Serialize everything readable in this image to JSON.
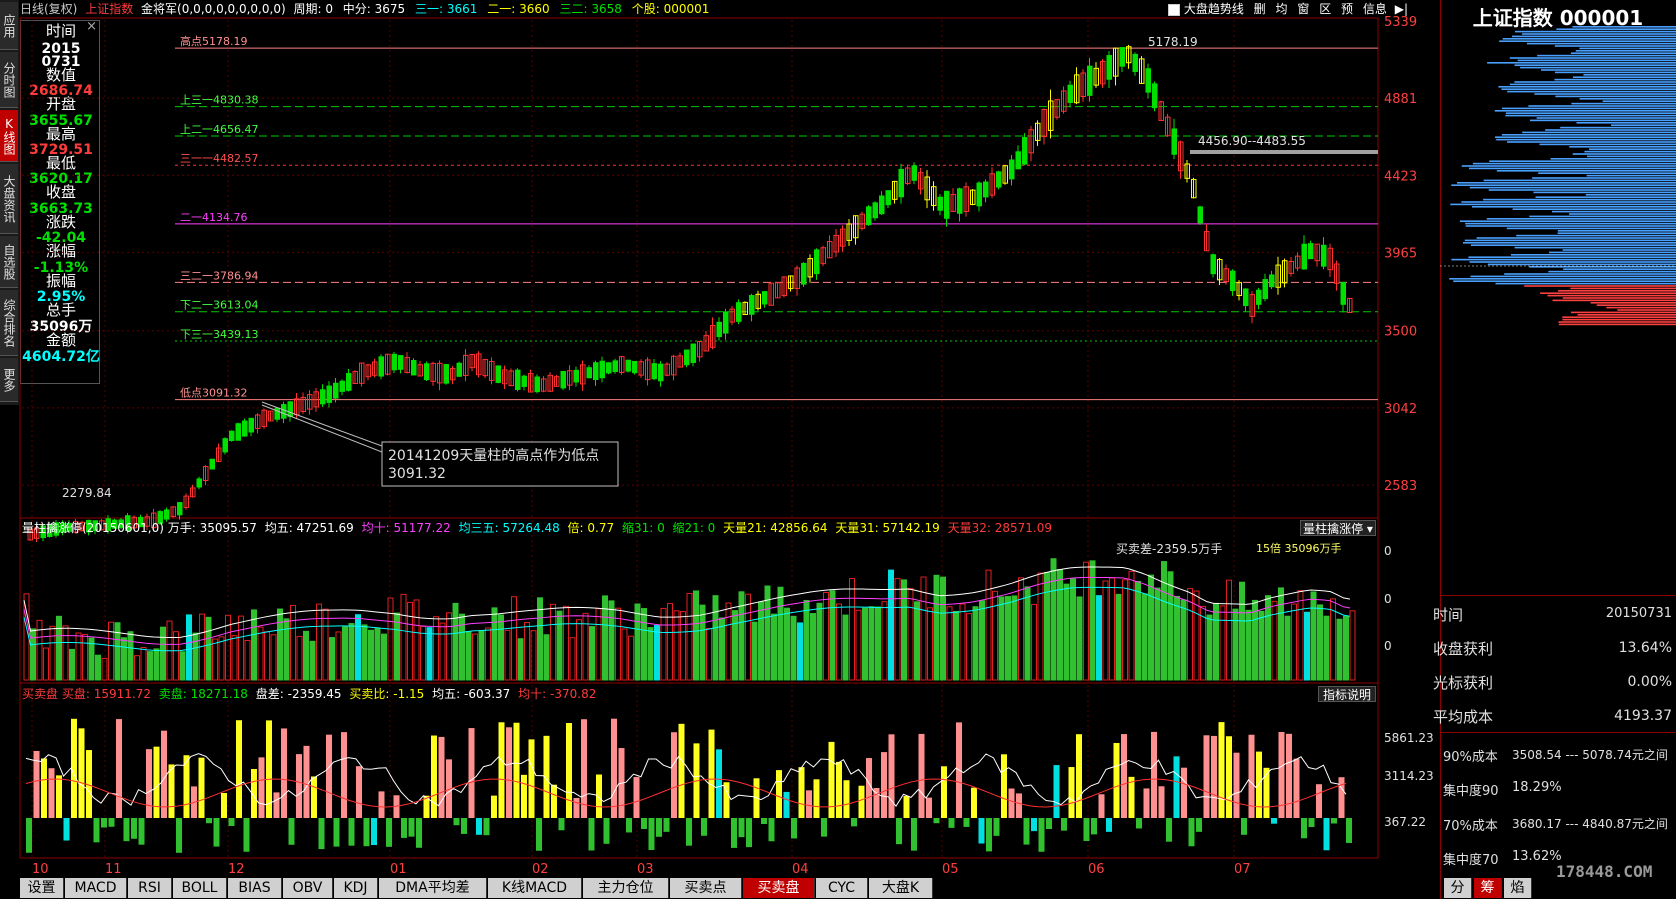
{
  "topbar": {
    "period": "日线(复权)",
    "index_name": "上证指数",
    "indicator": "金将军(0,0,0,0,0,0,0,0,0)",
    "cycle_label": "周期: 0",
    "mid_label": "中分: 3675",
    "s31_label": "三一: 3661",
    "e1_label": "二一: 3660",
    "s32_label": "三二: 3658",
    "stock_label": "个股: 000001",
    "btn_trend": "大盘趋势线",
    "btn_del": "删",
    "btn_jun": "均",
    "btn_win": "窗",
    "btn_area": "区",
    "btn_pre": "预",
    "btn_info": "信息"
  },
  "sidebar": {
    "items": [
      {
        "label": "应用"
      },
      {
        "label": "分时图"
      },
      {
        "label": "K线图"
      },
      {
        "label": "大盘资讯"
      },
      {
        "label": "自选股"
      },
      {
        "label": "综合排名"
      },
      {
        "label": "更多"
      }
    ]
  },
  "info_panel": {
    "time_label": "时间",
    "date_year": "2015",
    "date_md": "0731",
    "value_label": "数值",
    "value": "2686.74",
    "open_label": "开盘",
    "open": "3655.67",
    "high_label": "最高",
    "high": "3729.51",
    "low_label": "最低",
    "low": "3620.17",
    "close_label": "收盘",
    "close": "3663.73",
    "change_label": "涨跌",
    "change": "-42.04",
    "pct_label": "涨幅",
    "pct": "-1.13%",
    "amp_label": "振幅",
    "amp": "2.95%",
    "vol_label": "总手",
    "vol": "35096万",
    "amount_label": "金额",
    "amount": "4604.72亿"
  },
  "main_chart": {
    "levels": [
      {
        "label": "高点5178.19",
        "value": 5178.19
      },
      {
        "label": "上三一4830.38",
        "value": 4830.38
      },
      {
        "label": "上二一4656.47",
        "value": 4656.47
      },
      {
        "label": "三一一4482.57",
        "value": 4482.57
      },
      {
        "label": "二一4134.76",
        "value": 4134.76
      },
      {
        "label": "三二一3786.94",
        "value": 3786.94
      },
      {
        "label": "下二一3613.04",
        "value": 3613.04
      },
      {
        "label": "下三一3439.13",
        "value": 3439.13
      },
      {
        "label": "低点3091.32",
        "value": 3091.32
      }
    ],
    "peak_label": "5178.19",
    "low_start_label": "2279.84",
    "gap_label": "4456.90--4483.55",
    "annotation_line1": "20141209天量柱的高点作为低点",
    "annotation_line2": "3091.32",
    "y_ticks": [
      "5339",
      "4881",
      "4423",
      "3965",
      "3500",
      "3042",
      "2583"
    ]
  },
  "volume_panel": {
    "title": "量柱擒涨停(20150601,0)",
    "vol_label": "万手: 35095.57",
    "avg_label": "均五: 47251.69",
    "avg10_label": "均十: 51177.22",
    "avg35_label": "均三五: 57264.48",
    "mult_label": "倍: 0.77",
    "shrink31_label": "缩31: 0",
    "shrink21_label": "缩21: 0",
    "tian21_label": "天量21: 42856.64",
    "tian31_label": "天量31: 57142.19",
    "tian32_label": "天量32: 28571.09",
    "dropdown": "量柱擒涨停",
    "note1": "买卖差-2359.5万手",
    "note2": "15倍  35096万手",
    "y_ticks": [
      "0",
      "0",
      "0"
    ]
  },
  "bs_panel": {
    "title": "买卖盘",
    "buy_label": "买盘: 15911.72",
    "sell_label": "卖盘: 18271.18",
    "diff_label": "盘差: -2359.45",
    "ratio_label": "买卖比: -1.15",
    "avg5_label": "均五: -603.37",
    "avg10_label": "均十: -370.82",
    "help_btn": "指标说明",
    "y_ticks": [
      "5861.23",
      "3114.23",
      "367.22"
    ]
  },
  "x_axis": {
    "months": [
      "10",
      "11",
      "12",
      "01",
      "02",
      "03",
      "04",
      "05",
      "06",
      "07"
    ]
  },
  "bottom_tabs": {
    "items": [
      {
        "label": "设置"
      },
      {
        "label": "MACD"
      },
      {
        "label": "RSI"
      },
      {
        "label": "BOLL"
      },
      {
        "label": "BIAS"
      },
      {
        "label": "OBV"
      },
      {
        "label": "KDJ"
      },
      {
        "label": "DMA平均差"
      },
      {
        "label": "K线MACD"
      },
      {
        "label": "主力仓位"
      },
      {
        "label": "买卖点"
      },
      {
        "label": "买卖盘"
      },
      {
        "label": "CYC"
      },
      {
        "label": "大盘K"
      }
    ]
  },
  "right_panel": {
    "title": "上证指数 000001",
    "rows": [
      {
        "label": "时间",
        "value": "20150731"
      },
      {
        "label": "收盘获利",
        "value": "13.64%"
      },
      {
        "label": "光标获利",
        "value": "0.00%"
      },
      {
        "label": "平均成本",
        "value": "4193.37"
      }
    ],
    "cost90_label": "90%成本",
    "cost90_value": "3508.54 --- 5078.74元之间",
    "conc90_label": "集中度90",
    "conc90_value": "18.29%",
    "cost70_label": "70%成本",
    "cost70_value": "3680.17 --- 4840.87元之间",
    "conc70_label": "集中度70",
    "conc70_value": "13.62%",
    "tabs": [
      {
        "label": "分"
      },
      {
        "label": "筹"
      },
      {
        "label": "焰"
      }
    ],
    "watermark": "178448.COM"
  }
}
